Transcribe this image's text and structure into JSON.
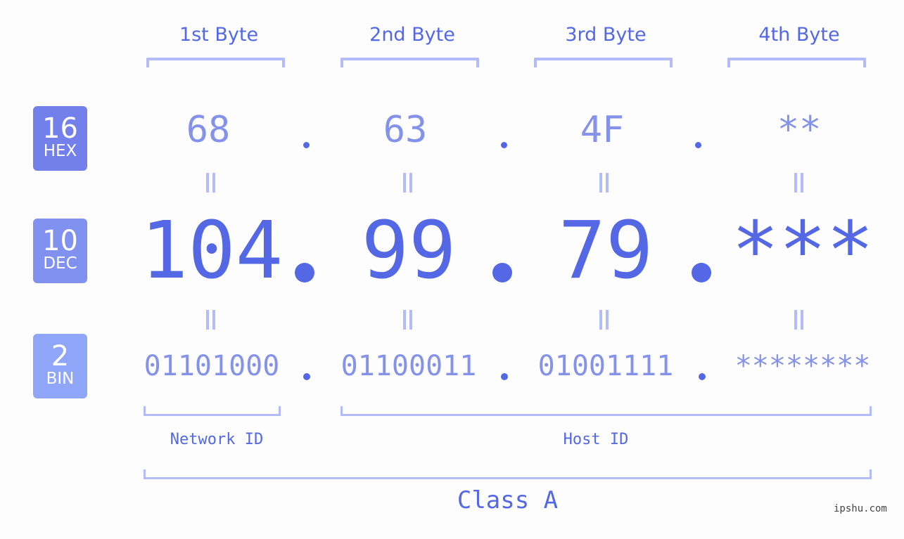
{
  "byte_headers": [
    "1st Byte",
    "2nd Byte",
    "3rd Byte",
    "4th Byte"
  ],
  "badges": {
    "hex": {
      "number": "16",
      "label": "HEX",
      "color": "#7380ec"
    },
    "dec": {
      "number": "10",
      "label": "DEC",
      "color": "#8191f0"
    },
    "bin": {
      "number": "2",
      "label": "BIN",
      "color": "#8fa5f8"
    }
  },
  "hex_values": [
    "68",
    "63",
    "4F",
    "**"
  ],
  "dec_values": [
    "104",
    "99",
    "79",
    "***"
  ],
  "bin_values": [
    "01101000",
    "01100011",
    "01001111",
    "********"
  ],
  "segments": {
    "network": "Network ID",
    "host": "Host ID",
    "class": "Class A"
  },
  "watermark": "ipshu.com",
  "colors": {
    "primary": "#5468e5",
    "secondary": "#8492ea",
    "bracket": "#b4bcf7"
  }
}
